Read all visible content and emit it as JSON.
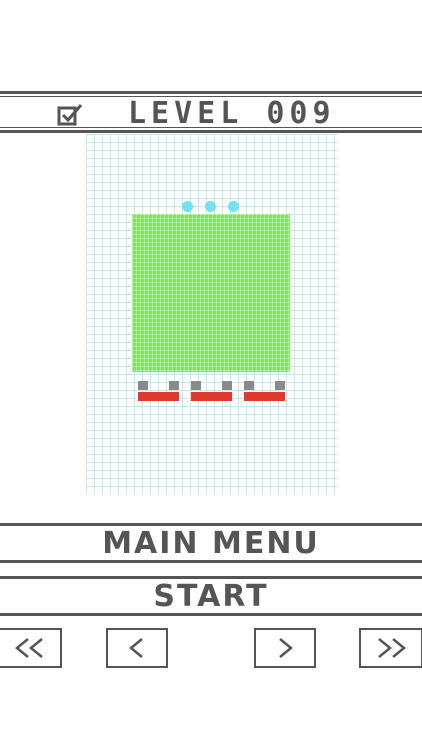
{
  "level": {
    "title": "LEVEL 009",
    "check_icon": "checkbox-checked-icon"
  },
  "board": {
    "grid_color": "#bfe9ec",
    "block_color": "#7ee35a",
    "dot_color": "#6fe3ef",
    "base_color": "#e0392d",
    "tab_color": "#8a8a8a",
    "dots_count": 3,
    "bases_count": 3
  },
  "menu": {
    "main_menu_label": "MAIN MENU",
    "start_label": "START"
  },
  "nav": {
    "first_icon": "double-chevron-left-icon",
    "prev_icon": "chevron-left-icon",
    "next_icon": "chevron-right-icon",
    "last_icon": "double-chevron-right-icon"
  }
}
